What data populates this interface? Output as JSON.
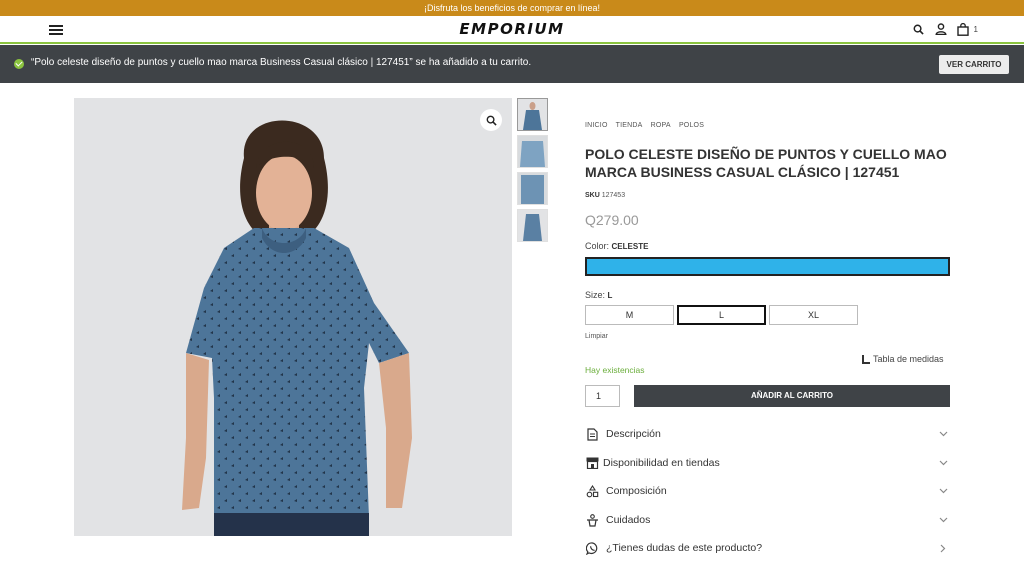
{
  "promo": {
    "text": "¡Disfruta los beneficios de comprar en línea!"
  },
  "header": {
    "logo": "EMPORIUM",
    "cart_count": "1"
  },
  "notice": {
    "message": "“Polo celeste diseño de puntos y cuello mao marca Business Casual clásico | 127451” se ha añadido a tu carrito.",
    "button": "VER CARRITO",
    "accent": "#8bc43f"
  },
  "breadcrumb": [
    "INICIO",
    "TIENDA",
    "ROPA",
    "POLOS"
  ],
  "product": {
    "title": "POLO CELESTE DISEÑO DE PUNTOS Y CUELLO MAO MARCA BUSINESS CASUAL CLÁSICO | 127451",
    "sku_label": "SKU",
    "sku": "127453",
    "price": "Q279.00",
    "color_label": "Color:",
    "color_value": "CELESTE",
    "swatch_color": "#2fb2e9",
    "size_label": "Size:",
    "size_value": "L",
    "sizes": [
      "M",
      "L",
      "XL"
    ],
    "selected_size": "L",
    "clear": "Limpiar",
    "size_chart": "Tabla de medidas",
    "stock": "Hay existencias",
    "quantity": "1",
    "add_to_cart": "AÑADIR AL CARRITO"
  },
  "accordion": [
    {
      "label": "Descripción",
      "icon": "document-icon"
    },
    {
      "label": "Disponibilidad en tiendas",
      "icon": "store-icon"
    },
    {
      "label": "Composición",
      "icon": "shapes-icon"
    },
    {
      "label": "Cuidados",
      "icon": "care-icon"
    },
    {
      "label": "¿Tienes dudas de este producto?",
      "icon": "whatsapp-icon"
    }
  ],
  "colors": {
    "header_dark": "#3f4347",
    "promo": "#c98a1a",
    "stock": "#6bae3c"
  }
}
